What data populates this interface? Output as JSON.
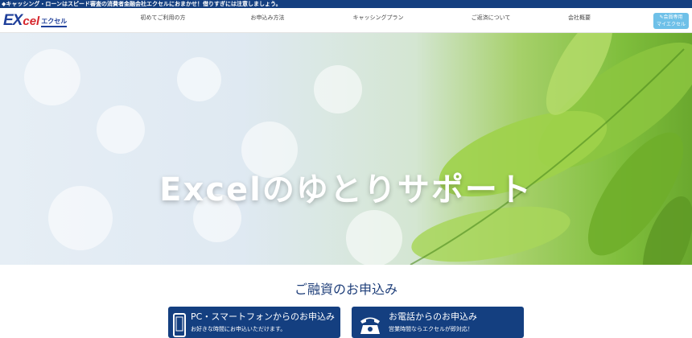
{
  "topbar": {
    "text": "◆キャッシング・ローンはスピード審査の消費者金融会社エクセルにおまかせ！借りすぎには注意しましょう。"
  },
  "logo": {
    "ex": "EX",
    "cel": "cel",
    "kana": "エクセル"
  },
  "nav": {
    "items": [
      {
        "label": "初めてご利用の方"
      },
      {
        "label": "お申込み方法"
      },
      {
        "label": "キャッシングプラン"
      },
      {
        "label": "ご返済について"
      },
      {
        "label": "会社概要"
      }
    ],
    "mypage": {
      "line1": "会員専用",
      "line2": "マイエクセル"
    }
  },
  "hero": {
    "title": "Excelのゆとりサポート"
  },
  "section": {
    "title": "ご融資のお申込み"
  },
  "cards": [
    {
      "icon": "smartphone-icon",
      "main": "PC・スマートフォンからのお申込み",
      "sub": "お好きな時間にお申込いただけます。"
    },
    {
      "icon": "telephone-icon",
      "main": "お電話からのお申込み",
      "sub": "営業時間ならエクセルが即対応！"
    }
  ],
  "colors": {
    "navy": "#143f80",
    "mypage": "#6ec0e8",
    "logo_blue": "#1f3f9a",
    "logo_red": "#d6252b"
  }
}
